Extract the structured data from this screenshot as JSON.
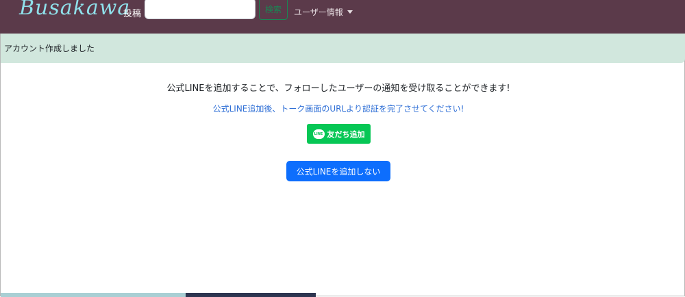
{
  "nav": {
    "logo": "Busakawa",
    "post_label": "投稿",
    "search_placeholder": "",
    "search_button": "検索",
    "user_menu": "ユーザー情報"
  },
  "alert": {
    "message": "アカウント作成しました"
  },
  "main": {
    "info_text": "公式LINEを追加することで、フォローしたユーザーの通知を受け取ることができます!",
    "instruction_text": "公式LINE追加後、トーク画面のURLより認証を完了させてください!",
    "line_button_label": "友だち追加",
    "line_icon_text": "LINE",
    "skip_button": "公式LINEを追加しない"
  },
  "colors": {
    "navbar": "#5b3a4a",
    "alert_bg": "#d1e7dd",
    "line_green": "#06c755",
    "primary": "#0d6efd",
    "link_blue": "#2f6fd6"
  }
}
